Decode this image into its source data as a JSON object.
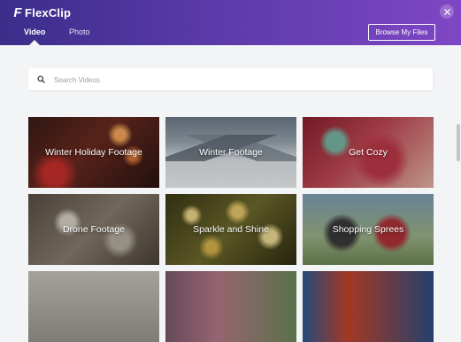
{
  "app": {
    "logo_text": "FlexClip",
    "logo_letter": "F"
  },
  "tabs": [
    {
      "label": "Video",
      "active": true
    },
    {
      "label": "Photo",
      "active": false
    }
  ],
  "toolbar": {
    "browse_label": "Browse My Files"
  },
  "search": {
    "placeholder": "Search Videos",
    "value": ""
  },
  "categories": [
    {
      "title": "Winter Holiday Footage"
    },
    {
      "title": "Winter Footage"
    },
    {
      "title": "Get Cozy"
    },
    {
      "title": "Drone Footage"
    },
    {
      "title": "Sparkle and Shine"
    },
    {
      "title": "Shopping Sprees"
    },
    {
      "title": ""
    },
    {
      "title": ""
    },
    {
      "title": ""
    }
  ],
  "colors": {
    "header_start": "#3b2d8a",
    "header_end": "#7f46c4",
    "background": "#f3f4f6"
  }
}
